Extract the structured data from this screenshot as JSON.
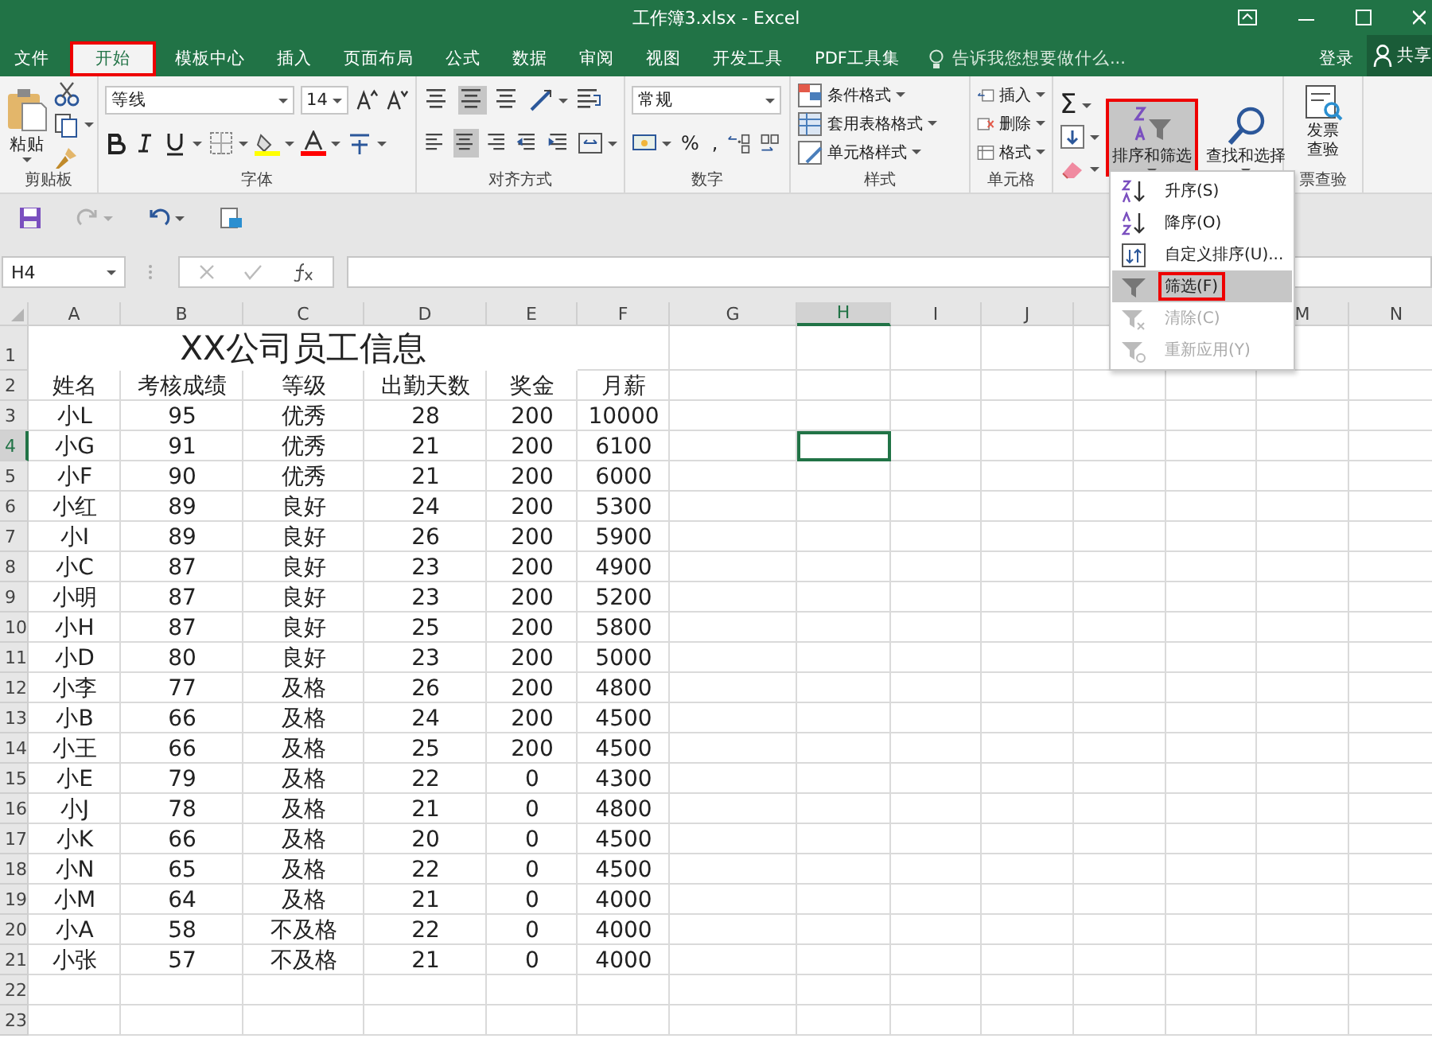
{
  "window": {
    "title": "工作簿3.xlsx - Excel"
  },
  "tabs": [
    {
      "label": "文件",
      "selected": false,
      "highlighted": false
    },
    {
      "label": "开始",
      "selected": true,
      "highlighted": true
    },
    {
      "label": "模板中心",
      "selected": false,
      "highlighted": false
    },
    {
      "label": "插入",
      "selected": false,
      "highlighted": false
    },
    {
      "label": "页面布局",
      "selected": false,
      "highlighted": false
    },
    {
      "label": "公式",
      "selected": false,
      "highlighted": false
    },
    {
      "label": "数据",
      "selected": false,
      "highlighted": false
    },
    {
      "label": "审阅",
      "selected": false,
      "highlighted": false
    },
    {
      "label": "视图",
      "selected": false,
      "highlighted": false
    },
    {
      "label": "开发工具",
      "selected": false,
      "highlighted": false
    },
    {
      "label": "PDF工具集",
      "selected": false,
      "highlighted": false
    }
  ],
  "tell_me": {
    "placeholder": "告诉我您想要做什么..."
  },
  "account": {
    "sign_in": "登录",
    "share": "共享"
  },
  "ribbon": {
    "clipboard": {
      "paste": "粘贴",
      "label": "剪贴板"
    },
    "font": {
      "name": "等线",
      "size": "14",
      "label": "字体"
    },
    "alignment": {
      "label": "对齐方式"
    },
    "number": {
      "format": "常规",
      "percent": "%",
      "comma": ",",
      "label": "数字"
    },
    "styles": {
      "items": [
        "条件格式",
        "套用表格格式",
        "单元格样式"
      ],
      "label": "样式"
    },
    "cells": {
      "items": [
        "插入",
        "删除",
        "格式"
      ],
      "label": "单元格"
    },
    "editing": {
      "sum": "Σ",
      "buttons": [
        {
          "label": "排序和筛选",
          "highlighted": true
        },
        {
          "label": "查找和选择",
          "highlighted": false
        }
      ]
    },
    "invoice": {
      "lines": [
        "发票",
        "查验"
      ],
      "label": "票查验"
    }
  },
  "name_box": {
    "value": "H4"
  },
  "sheet": {
    "columns": [
      {
        "label": "A",
        "selected": false
      },
      {
        "label": "B",
        "selected": false
      },
      {
        "label": "C",
        "selected": false
      },
      {
        "label": "D",
        "selected": false
      },
      {
        "label": "E",
        "selected": false
      },
      {
        "label": "F",
        "selected": false
      },
      {
        "label": "G",
        "selected": false
      },
      {
        "label": "H",
        "selected": true
      },
      {
        "label": "I",
        "selected": false
      },
      {
        "label": "J",
        "selected": false
      },
      {},
      null,
      {
        "label": "M",
        "selected": false
      },
      {
        "label": "N",
        "selected": false
      }
    ],
    "rows": [
      {
        "number": "1",
        "selected": false,
        "title": "XX公司员工信息"
      },
      {
        "number": "2",
        "selected": false,
        "cells": [
          "姓名",
          "考核成绩",
          "等级",
          "出勤天数",
          "奖金",
          "月薪"
        ]
      },
      {
        "number": "3",
        "selected": false,
        "cells": [
          "小L",
          "95",
          "优秀",
          "28",
          "200",
          "10000"
        ]
      },
      {
        "number": "4",
        "selected": true,
        "cells": [
          "小G",
          "91",
          "优秀",
          "21",
          "200",
          "6100"
        ]
      },
      {
        "number": "5",
        "selected": false,
        "cells": [
          "小F",
          "90",
          "优秀",
          "21",
          "200",
          "6000"
        ]
      },
      {
        "number": "6",
        "selected": false,
        "cells": [
          "小红",
          "89",
          "良好",
          "24",
          "200",
          "5300"
        ]
      },
      {
        "number": "7",
        "selected": false,
        "cells": [
          "小I",
          "89",
          "良好",
          "26",
          "200",
          "5900"
        ]
      },
      {
        "number": "8",
        "selected": false,
        "cells": [
          "小C",
          "87",
          "良好",
          "23",
          "200",
          "4900"
        ]
      },
      {
        "number": "9",
        "selected": false,
        "cells": [
          "小明",
          "87",
          "良好",
          "23",
          "200",
          "5200"
        ]
      },
      {
        "number": "10",
        "selected": false,
        "cells": [
          "小H",
          "87",
          "良好",
          "25",
          "200",
          "5800"
        ]
      },
      {
        "number": "11",
        "selected": false,
        "cells": [
          "小D",
          "80",
          "良好",
          "23",
          "200",
          "5000"
        ]
      },
      {
        "number": "12",
        "selected": false,
        "cells": [
          "小李",
          "77",
          "及格",
          "26",
          "200",
          "4800"
        ]
      },
      {
        "number": "13",
        "selected": false,
        "cells": [
          "小B",
          "66",
          "及格",
          "24",
          "200",
          "4500"
        ]
      },
      {
        "number": "14",
        "selected": false,
        "cells": [
          "小王",
          "66",
          "及格",
          "25",
          "200",
          "4500"
        ]
      },
      {
        "number": "15",
        "selected": false,
        "cells": [
          "小E",
          "79",
          "及格",
          "22",
          "0",
          "4300"
        ]
      },
      {
        "number": "16",
        "selected": false,
        "cells": [
          "小J",
          "78",
          "及格",
          "21",
          "0",
          "4800"
        ]
      },
      {
        "number": "17",
        "selected": false,
        "cells": [
          "小K",
          "66",
          "及格",
          "20",
          "0",
          "4500"
        ]
      },
      {
        "number": "18",
        "selected": false,
        "cells": [
          "小N",
          "65",
          "及格",
          "22",
          "0",
          "4500"
        ]
      },
      {
        "number": "19",
        "selected": false,
        "cells": [
          "小M",
          "64",
          "及格",
          "21",
          "0",
          "4000"
        ]
      },
      {
        "number": "20",
        "selected": false,
        "cells": [
          "小A",
          "58",
          "不及格",
          "22",
          "0",
          "4000"
        ]
      },
      {
        "number": "21",
        "selected": false,
        "cells": [
          "小张",
          "57",
          "不及格",
          "21",
          "0",
          "4000"
        ]
      },
      {
        "number": "22",
        "selected": false
      },
      {
        "number": "23",
        "selected": false
      }
    ]
  },
  "sort_menu": {
    "items": [
      {
        "kind": "asc",
        "label": "升序(S)",
        "disabled": false,
        "selected": false,
        "highlighted": false
      },
      {
        "kind": "desc",
        "label": "降序(O)",
        "disabled": false,
        "selected": false,
        "highlighted": false
      },
      {
        "kind": "custom",
        "label": "自定义排序(U)...",
        "disabled": false,
        "selected": false,
        "highlighted": false
      },
      {
        "kind": "filter",
        "label": "筛选(F)",
        "disabled": false,
        "selected": true,
        "highlighted": true
      },
      {
        "kind": "clear",
        "label": "清除(C)",
        "disabled": true,
        "selected": false,
        "highlighted": false
      },
      {
        "kind": "reapply",
        "label": "重新应用(Y)",
        "disabled": true,
        "selected": false,
        "highlighted": false
      }
    ]
  }
}
